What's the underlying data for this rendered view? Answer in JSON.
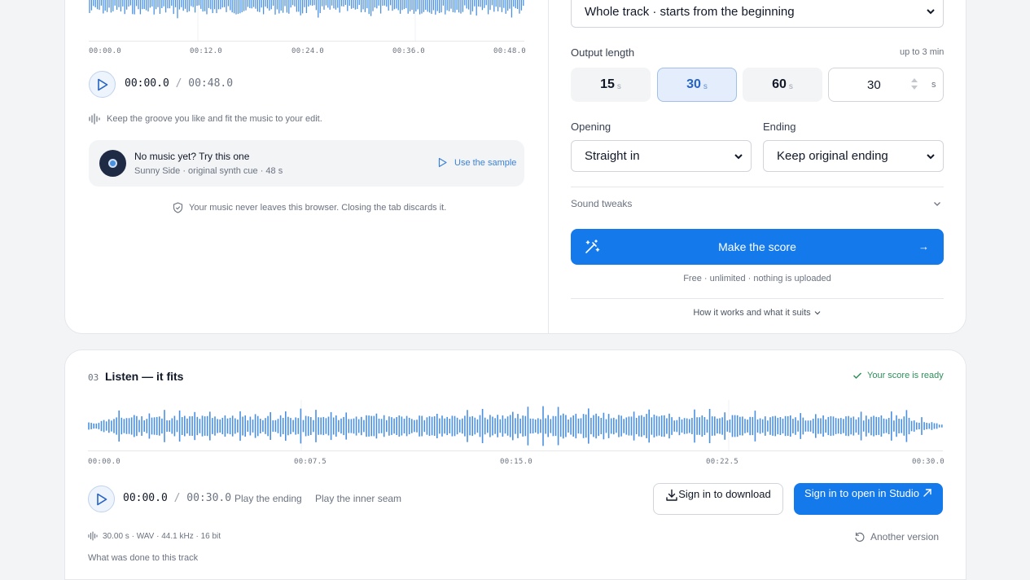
{
  "source": {
    "ticks": [
      "00:00.0",
      "00:12.0",
      "00:24.0",
      "00:36.0",
      "00:48.0"
    ],
    "current_time": "00:00.0",
    "separator": "/",
    "total_time": "00:48.0",
    "hint": "Keep the groove you like and fit the music to your edit.",
    "sample_card": {
      "title": "No music yet? Try this one",
      "subtitle": "Sunny Side · original synth cue · 48 s",
      "action": "Use the sample"
    },
    "privacy_note": "Your music never leaves this browser. Closing the tab discards it."
  },
  "settings": {
    "section_select": "Whole track · starts from the beginning",
    "output_length_label": "Output length",
    "output_length_limit": "up to 3 min",
    "length_options": [
      {
        "value": "15",
        "unit": "s"
      },
      {
        "value": "30",
        "unit": "s"
      },
      {
        "value": "60",
        "unit": "s"
      }
    ],
    "selected_length": "30",
    "custom_value": "30",
    "custom_unit": "s",
    "opening_label": "Opening",
    "opening_value": "Straight in",
    "ending_label": "Ending",
    "ending_value": "Keep original ending",
    "sound_tweaks": "Sound tweaks",
    "cta_label": "Make the score",
    "cta_arrow": "→",
    "cta_note": "Free · unlimited · nothing is uploaded",
    "how_it_works": "How it works and what it suits"
  },
  "result": {
    "step_number": "03",
    "title": "Listen — it fits",
    "status": "Your score is ready",
    "ticks": [
      "00:00.0",
      "00:07.5",
      "00:15.0",
      "00:22.5",
      "00:30.0"
    ],
    "current_time": "00:00.0",
    "separator": "/",
    "total_time": "00:30.0",
    "play_ending": "Play the ending",
    "play_seam": "Play the inner seam",
    "download_label": "Sign in to download",
    "studio_label": "Sign in to open in Studio",
    "file_info": "30.00 s · WAV · 44.1 kHz · 16 bit",
    "another_version": "Another version",
    "what_was_done": "What was done to this track"
  },
  "colors": {
    "accent": "#1479ea",
    "waveform": "#4a90e2",
    "success": "#2f8f5b"
  }
}
